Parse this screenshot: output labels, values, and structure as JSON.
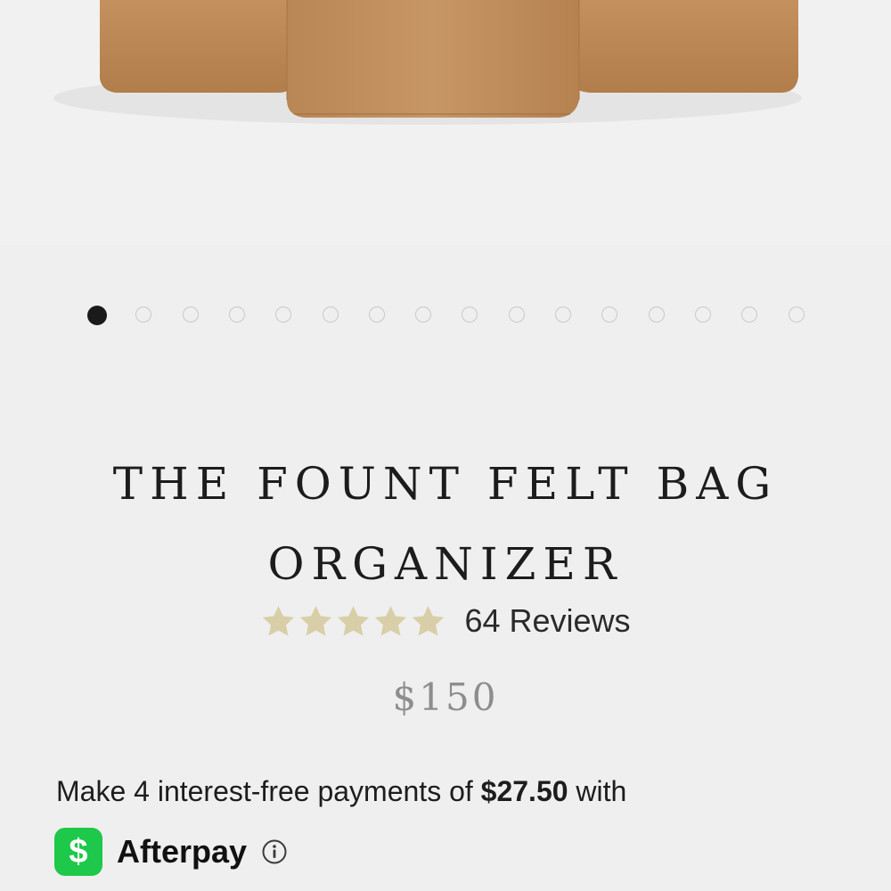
{
  "product": {
    "title_line1": "THE FOUNT FELT BAG",
    "title_line2": "ORGANIZER",
    "reviews_label": "64 Reviews",
    "rating": 5,
    "rating_max": 5,
    "price": "$150"
  },
  "carousel": {
    "total_slides": 16,
    "active_index": 0
  },
  "afterpay": {
    "text_before": "Make 4 interest-free payments of ",
    "amount": "$27.50",
    "text_after": " with",
    "brand_icon_glyph": "$",
    "brand_label": "Afterpay"
  },
  "icons": {
    "star": "star-icon",
    "brand": "cash-app-icon",
    "info": "info-icon"
  },
  "colors": {
    "background": "#efefef",
    "star": "#d8cfa8",
    "cash_app_green": "#1ec84a",
    "felt": "#bf8a57",
    "price": "#8d8d8d"
  }
}
